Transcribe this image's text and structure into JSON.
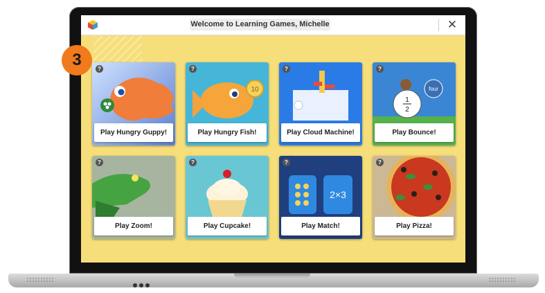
{
  "window": {
    "title": "Welcome to Learning Games, Michelle",
    "app_icon": "cube-icon",
    "close_symbol": "✕"
  },
  "step_badge": "3",
  "help_symbol": "?",
  "cards": [
    {
      "label": "Play Hungry Guppy!",
      "icon": "guppy-fish-icon",
      "accent": "#6a8fd6"
    },
    {
      "label": "Play Hungry Fish!",
      "icon": "orange-fish-icon",
      "accent": "#3fb2d6",
      "badge": "10"
    },
    {
      "label": "Play Cloud Machine!",
      "icon": "cloud-machine-icon",
      "accent": "#1f6fe0"
    },
    {
      "label": "Play Bounce!",
      "icon": "monkey-balloon-icon",
      "accent": "#2e73c7",
      "fraction_num": "1",
      "fraction_den": "2",
      "balloon_word": "four"
    },
    {
      "label": "Play Zoom!",
      "icon": "frog-icon",
      "accent": "#9aa88f"
    },
    {
      "label": "Play Cupcake!",
      "icon": "cupcake-icon",
      "accent": "#5cc0cc"
    },
    {
      "label": "Play Match!",
      "icon": "match-cards-icon",
      "accent": "#1b3c7a",
      "expression": "2×3"
    },
    {
      "label": "Play Pizza!",
      "icon": "pizza-icon",
      "accent": "#c9b595"
    }
  ]
}
